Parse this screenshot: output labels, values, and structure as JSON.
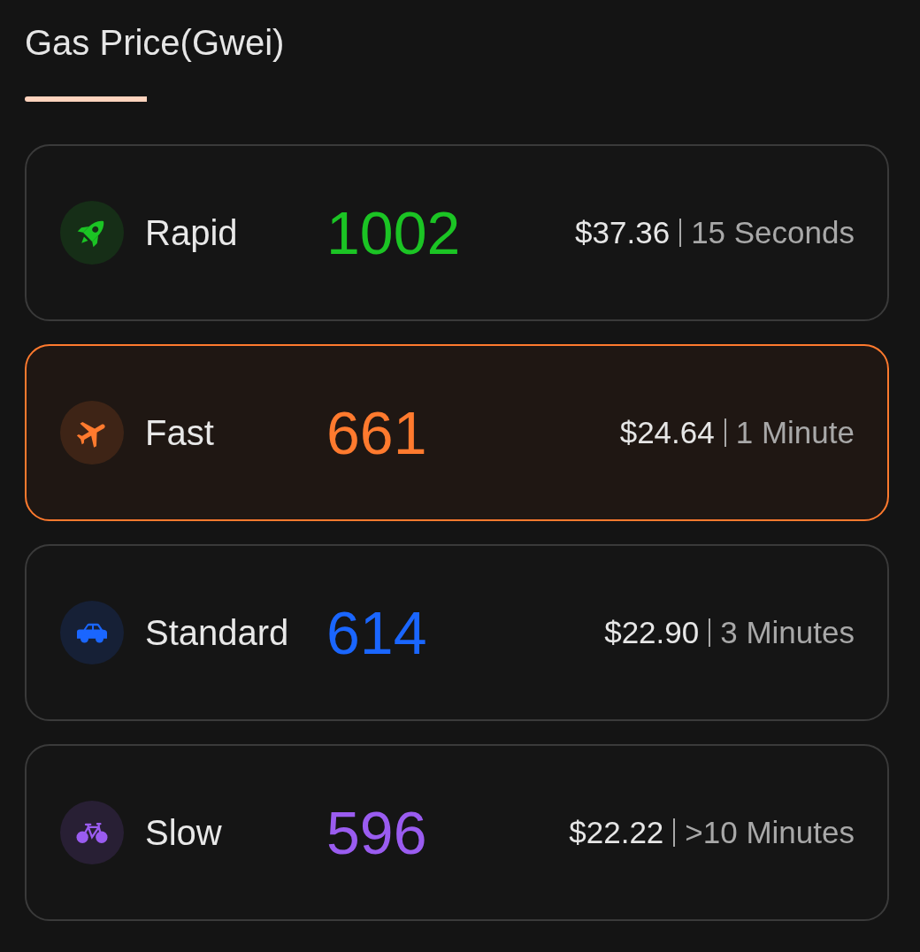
{
  "title": "Gas Price(Gwei)",
  "options": [
    {
      "kind": "rocket",
      "label": "Rapid",
      "value": "1002",
      "price": "$37.36",
      "time": "15 Seconds",
      "color": "#1bc424",
      "selected": false
    },
    {
      "kind": "plane",
      "label": "Fast",
      "value": "661",
      "price": "$24.64",
      "time": "1 Minute",
      "color": "#ff7a2e",
      "selected": true
    },
    {
      "kind": "car",
      "label": "Standard",
      "value": "614",
      "price": "$22.90",
      "time": "3 Minutes",
      "color": "#1a66ff",
      "selected": false
    },
    {
      "kind": "bicycle",
      "label": "Slow",
      "value": "596",
      "price": "$22.22",
      "time": ">10 Minutes",
      "color": "#9a5cf0",
      "selected": false
    }
  ]
}
